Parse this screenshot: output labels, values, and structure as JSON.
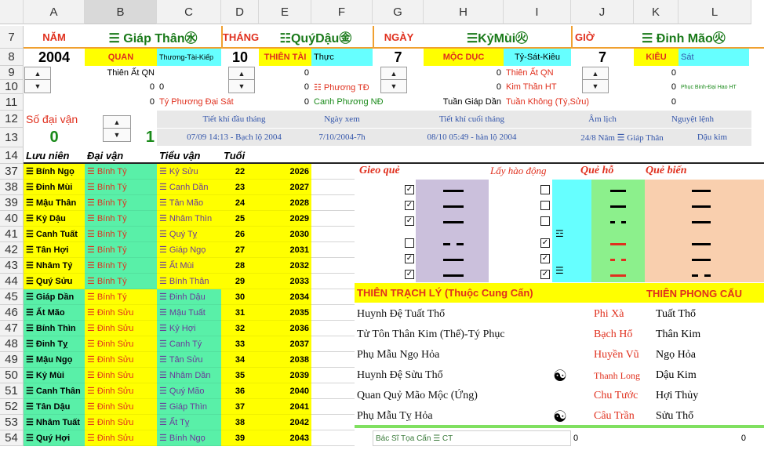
{
  "columns": [
    "A",
    "B",
    "C",
    "D",
    "E",
    "F",
    "G",
    "H",
    "I",
    "J",
    "K",
    "L"
  ],
  "rows": [
    "7",
    "8",
    "9",
    "10",
    "11",
    "12",
    "13",
    "14",
    "37",
    "38",
    "39",
    "40",
    "41",
    "42",
    "43",
    "44",
    "45",
    "46",
    "47",
    "48",
    "49",
    "50",
    "51",
    "52",
    "53",
    "54"
  ],
  "r7": {
    "nam": "NĂM",
    "giap_than": "☰ Giáp Thân㊌",
    "thang": "THÁNG",
    "quy_dau": "☷QuýDậu㊎",
    "ngay": "NGÀY",
    "ky_mui": "☰KỷMùi㊋",
    "gio": "GIỜ",
    "dinh_mao": "☰ Đinh Mão㊋"
  },
  "r8": {
    "year": "2004",
    "quan": "QUAN",
    "thuong_tai": "Thương-Tài-Kiếp",
    "month": "10",
    "thien_tai": "THIÊN TÀI",
    "thuc": "Thực",
    "day": "7",
    "moc_duc": "MỘC DỤC",
    "ty_sat": "Tỷ-Sát-Kiêu",
    "hour": "7",
    "kieu": "KIÊU",
    "sat": "Sát"
  },
  "r9": {
    "thien_at": "Thiên Ất QN",
    "e": "0",
    "h": "0",
    "i": "Thiên Ất QN",
    "k": "0"
  },
  "r10": {
    "b": "0",
    "c": "0",
    "e": "0",
    "f": "☷ Phương TĐ",
    "h": "0",
    "i": "Kim Thần HT",
    "k": "0",
    "l": "Phục Binh-Đại Hao HT"
  },
  "r11": {
    "b": "0",
    "c": "Tý Phương Đại Sát",
    "e": "0",
    "f": "Canh Phương NĐ",
    "h": "Tuần Giáp Dần",
    "i": "Tuần Không (Tý,Sửu)",
    "k": "0"
  },
  "r12": {
    "so_dai_van": "Số đại vận",
    "tiet_khi_dau": "Tiết khí đầu tháng",
    "ngay_xem": "Ngày xem",
    "tiet_khi_cuoi": "Tiết khí cuối tháng",
    "am_lich": "Âm lịch",
    "nguyet_lenh": "Nguyệt lệnh"
  },
  "r13": {
    "a": "0",
    "b": "1",
    "tiet_dau_val": "07/09 14:13 - Bạch lộ 2004",
    "ngay_xem_val": "7/10/2004-7h",
    "tiet_cuoi_val": "08/10 05:49 - hàn lộ 2004",
    "am_lich_val": "24/8 Năm ☰ Giáp Thân",
    "nguyet_lenh_val": "Dậu kim"
  },
  "r14": {
    "luu_nien": "Lưu niên",
    "dai_van": "Đại vận",
    "tieu_van": "Tiểu vận",
    "tuoi": "Tuổi"
  },
  "table": [
    {
      "ln": "☰ Bính Ngọ",
      "dv": "☰ Bính Tý",
      "tv": "☰ Kỷ Sửu",
      "age": "22",
      "yr": "2026"
    },
    {
      "ln": "☰ Đinh Mùi",
      "dv": "☰ Bính Tý",
      "tv": "☰ Canh Dần",
      "age": "23",
      "yr": "2027"
    },
    {
      "ln": "☰ Mậu Thân",
      "dv": "☰ Bính Tý",
      "tv": "☰ Tân Mão",
      "age": "24",
      "yr": "2028"
    },
    {
      "ln": "☰ Kỷ Dậu",
      "dv": "☰ Bính Tý",
      "tv": "☰ Nhâm Thìn",
      "age": "25",
      "yr": "2029"
    },
    {
      "ln": "☰ Canh Tuất",
      "dv": "☰ Bính Tý",
      "tv": "☰ Quý Tỵ",
      "age": "26",
      "yr": "2030"
    },
    {
      "ln": "☰ Tân Hợi",
      "dv": "☰ Bính Tý",
      "tv": "☰ Giáp Ngọ",
      "age": "27",
      "yr": "2031"
    },
    {
      "ln": "☰ Nhâm Tý",
      "dv": "☰ Bính Tý",
      "tv": "☰ Ất Mùi",
      "age": "28",
      "yr": "2032"
    },
    {
      "ln": "☰ Quý Sửu",
      "dv": "☰ Bính Tý",
      "tv": "☰ Bính Thân",
      "age": "29",
      "yr": "2033"
    },
    {
      "ln": "☰ Giáp Dần",
      "dv": "☰ Bính Tý",
      "tv": "☰ Đinh Dậu",
      "age": "30",
      "yr": "2034"
    },
    {
      "ln": "☰ Ất Mão",
      "dv": "☰ Đinh Sửu",
      "tv": "☰ Mậu Tuất",
      "age": "31",
      "yr": "2035"
    },
    {
      "ln": "☰ Bính Thìn",
      "dv": "☰ Đinh Sửu",
      "tv": "☰ Kỷ Hợi",
      "age": "32",
      "yr": "2036"
    },
    {
      "ln": "☰ Đinh Tỵ",
      "dv": "☰ Đinh Sửu",
      "tv": "☰ Canh Tý",
      "age": "33",
      "yr": "2037"
    },
    {
      "ln": "☰ Mậu Ngọ",
      "dv": "☰ Đinh Sửu",
      "tv": "☰ Tân Sửu",
      "age": "34",
      "yr": "2038"
    },
    {
      "ln": "☰ Kỷ Mùi",
      "dv": "☰ Đinh Sửu",
      "tv": "☰ Nhâm Dần",
      "age": "35",
      "yr": "2039"
    },
    {
      "ln": "☰ Canh Thân",
      "dv": "☰ Đinh Sửu",
      "tv": "☰ Quý Mão",
      "age": "36",
      "yr": "2040"
    },
    {
      "ln": "☰ Tân Dậu",
      "dv": "☰ Đinh Sửu",
      "tv": "☰ Giáp Thìn",
      "age": "37",
      "yr": "2041"
    },
    {
      "ln": "☰ Nhâm Tuất",
      "dv": "☰ Đinh Sửu",
      "tv": "☰ Ất Tỵ",
      "age": "38",
      "yr": "2042"
    },
    {
      "ln": "☰ Quý Hợi",
      "dv": "☰ Đinh Sửu",
      "tv": "☰ Bính Ngọ",
      "age": "39",
      "yr": "2043"
    }
  ],
  "gua": {
    "gieo_que": "Gieo quẻ",
    "lay_hao": "Lấy hào động",
    "que_ho": "Quẻ hỗ",
    "que_bien": "Quẻ biến",
    "ho_sym1": "☲",
    "ho_sym2": "☰"
  },
  "gua_title": {
    "left": "THIÊN TRẠCH LÝ (Thuộc Cung Cấn)",
    "right": "THIÊN PHONG CẤU"
  },
  "gua_rows": [
    {
      "main": "Huynh Đệ Tuất Thổ",
      "god": "Phi Xà",
      "bien": "Tuất Thổ",
      "yy": ""
    },
    {
      "main": "Tử Tôn Thân Kim (Thế)-Tý Phục",
      "god": "Bạch Hổ",
      "bien": "Thân Kim",
      "yy": ""
    },
    {
      "main": "Phụ Mẫu Ngọ Hỏa",
      "god": "Huyền Vũ",
      "bien": "Ngọ Hỏa",
      "yy": ""
    },
    {
      "main": "Huynh Đệ Sửu Thổ",
      "god": "Thanh Long",
      "bien": "Dậu Kim",
      "yy": "☯"
    },
    {
      "main": "Quan Quỷ Mão Mộc (Ứng)",
      "god": "Chu Tước",
      "bien": "Hợi Thủy",
      "yy": ""
    },
    {
      "main": "Phụ Mẫu Tỵ Hỏa",
      "god": "Câu Trần",
      "bien": "Sửu Thổ",
      "yy": "☯"
    }
  ],
  "r54": {
    "f": "Bác Sĩ Tọa Cấn ☰ CT",
    "i": "0",
    "l": "0"
  }
}
